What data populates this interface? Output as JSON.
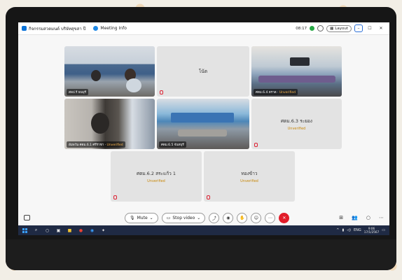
{
  "window": {
    "title": "กิจกรรมสวดมนต์ บริษัทสุขสา ปี",
    "meeting_info": "Meeting Info",
    "time": "08:17",
    "layout_label": "Layout"
  },
  "tiles": [
    {
      "label": "สพป.ร้ ธนบุรี",
      "status": ""
    },
    {
      "name": "โน้ต",
      "status": ""
    },
    {
      "label": "ศตม.6.4 ตราด",
      "status": "Unverified"
    },
    {
      "label": "อัมพวัน ศตม.6.1 ศรีราชา",
      "status": "Unverified"
    },
    {
      "label": "ศตม.6.5 จันทบุรี",
      "status": ""
    },
    {
      "name": "ศตม.6.3 ระยอง",
      "status": "Unverified"
    },
    {
      "name": "ศตม.6.2 สระแก้ว 1",
      "status": "Unverified"
    },
    {
      "name": "ทองข้าว",
      "status": "Unverified"
    }
  ],
  "controls": {
    "mute_label": "Mute",
    "stop_video_label": "Stop video"
  },
  "taskbar": {
    "language": "ENG",
    "time": "9:06",
    "date": "17/1/2567"
  }
}
